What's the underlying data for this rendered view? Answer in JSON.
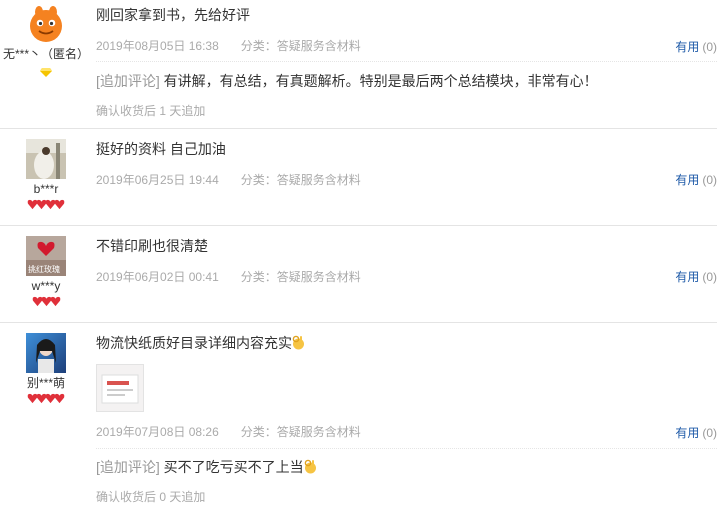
{
  "colors": {
    "link": "#1e5aa8",
    "muted": "#aaaaaa",
    "badge_red": "#e0303a",
    "vip_gold": "#f5c400"
  },
  "reviews": [
    {
      "user": "无***丶（匿名）",
      "avatar_icon": "orange-cartoon-avatar-icon",
      "content": "刚回家拿到书，先给好评",
      "date": "2019年08月05日 16:38",
      "category": "分类：答疑服务含材料",
      "useful_label": "有用",
      "useful_count": "(0)",
      "append_tag": "[追加评论]",
      "append_text": "有讲解，有总结，有真题解析。特别是最后两个总结模块，非常有心！",
      "append_note": "确认收货后 1 天追加"
    },
    {
      "user": "b***r",
      "avatar_icon": "photo-avatar-icon",
      "content": "挺好的资料 自己加油",
      "date": "2019年06月25日 19:44",
      "category": "分类：答疑服务含材料",
      "useful_label": "有用",
      "useful_count": "(0)"
    },
    {
      "user": "w***y",
      "avatar_icon": "photo-avatar-icon",
      "avatar_caption": "挑红玫瑰",
      "content": "不错印刷也很清楚",
      "date": "2019年06月02日 00:41",
      "category": "分类：答疑服务含材料",
      "useful_label": "有用",
      "useful_count": "(0)"
    },
    {
      "user": "别***萌",
      "avatar_icon": "photo-avatar-icon",
      "content": "物流快纸质好目录详细内容充实",
      "date": "2019年07月08日 08:26",
      "category": "分类：答疑服务含材料",
      "useful_label": "有用",
      "useful_count": "(0)",
      "append_tag": "[追加评论]",
      "append_text": "买不了吃亏买不了上当",
      "append_note": "确认收货后 0 天追加"
    }
  ]
}
